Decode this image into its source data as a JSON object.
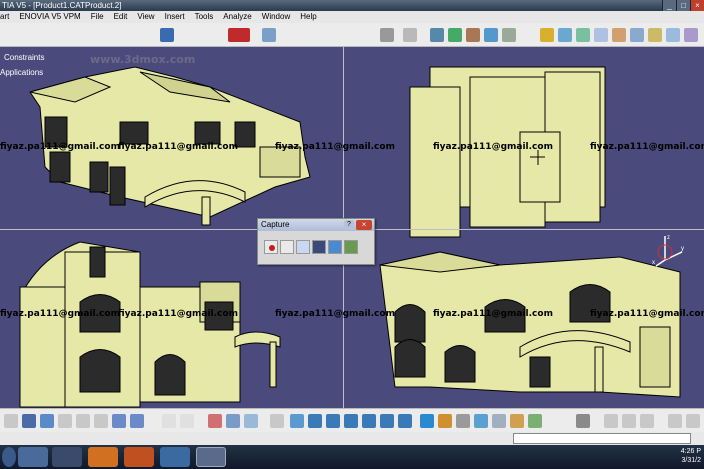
{
  "window": {
    "title": "TIA V5 - [Product1.CATProduct.2]"
  },
  "menu": [
    "art",
    "ENOVIA V5 VPM",
    "File",
    "Edit",
    "View",
    "Insert",
    "Tools",
    "Analyze",
    "Window",
    "Help"
  ],
  "tree": {
    "constraints": "Constraints",
    "applications": "Applications"
  },
  "watermark": {
    "site": "www.3dmox.com",
    "email": "fiyaz.pa111@gmail.com"
  },
  "capture": {
    "title": "Capture"
  },
  "compass": {
    "axis_x": "x",
    "axis_y": "y",
    "axis_z": "z"
  },
  "clock": {
    "time": "4:26 P",
    "date": "3/31/2"
  },
  "colors": {
    "viewport": "#4a4b7c",
    "house": "#e6e8a8",
    "outline": "#000000"
  }
}
